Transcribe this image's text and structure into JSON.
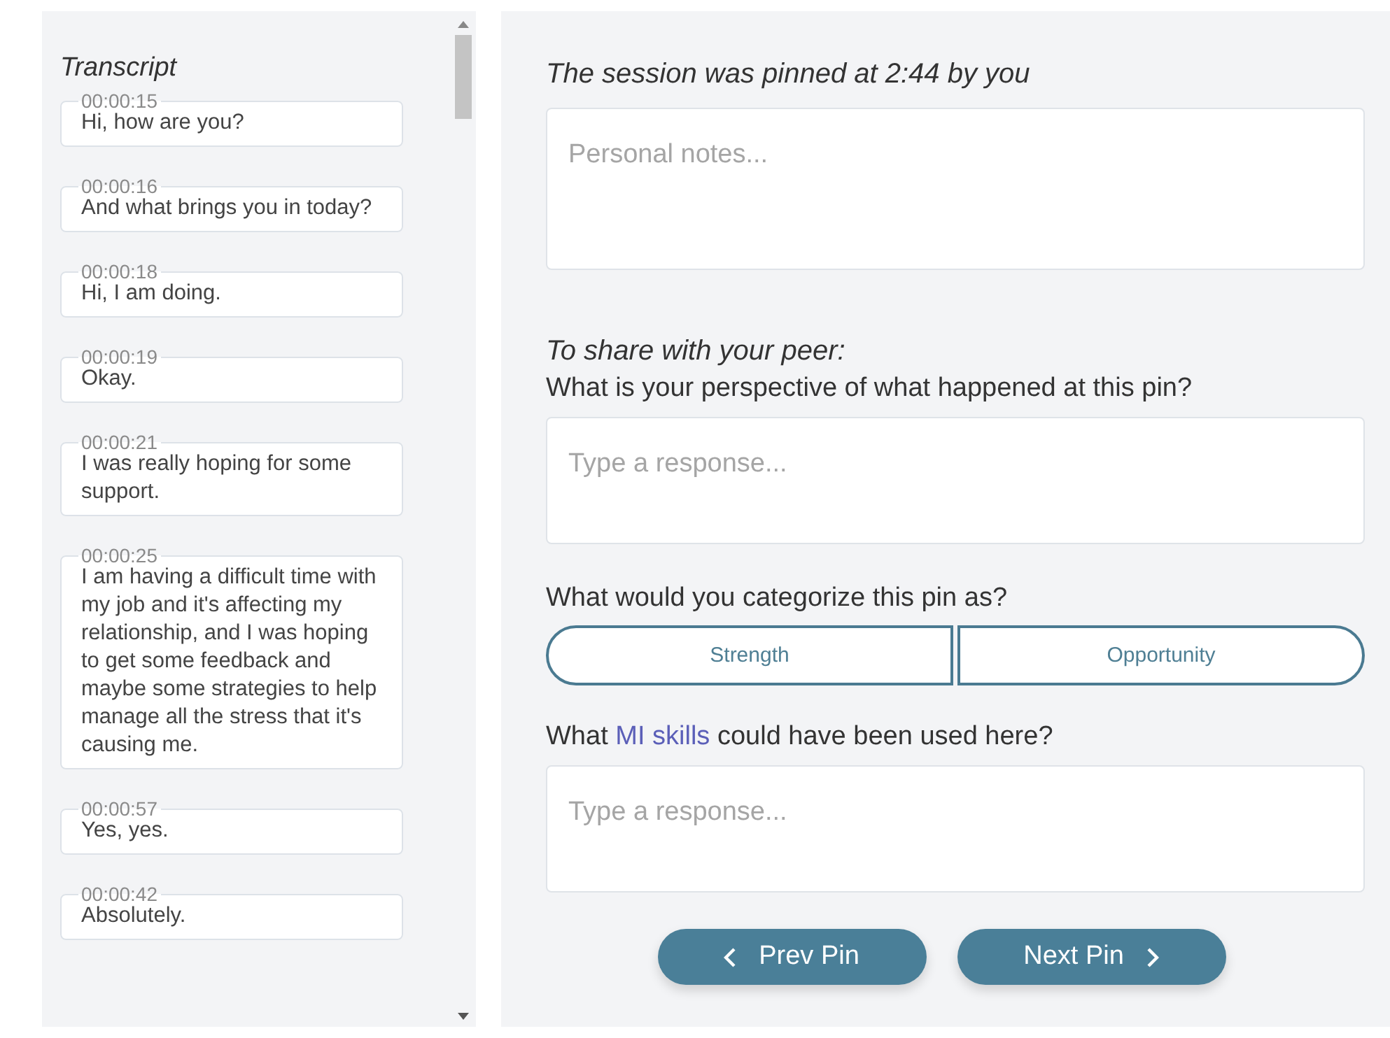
{
  "transcript": {
    "title": "Transcript",
    "entries": [
      {
        "time": "00:00:15",
        "text": "Hi, how are you?"
      },
      {
        "time": "00:00:16",
        "text": "And what brings you in today?"
      },
      {
        "time": "00:00:18",
        "text": "Hi, I am doing."
      },
      {
        "time": "00:00:19",
        "text": "Okay."
      },
      {
        "time": "00:00:21",
        "text": "I was really hoping for some support."
      },
      {
        "time": "00:00:25",
        "text": "I am having a difficult time with my job and it's affecting my relationship, and I was hoping to get some feedback and maybe some strategies to help manage all the stress that it's causing me."
      },
      {
        "time": "00:00:57",
        "text": "Yes, yes."
      },
      {
        "time": "00:00:42",
        "text": "Absolutely."
      }
    ]
  },
  "pin": {
    "heading": "The session was pinned at 2:44 by you",
    "notes_placeholder": "Personal notes...",
    "share_heading": "To share with your peer:",
    "perspective_question": "What is your perspective of what happened at this pin?",
    "perspective_placeholder": "Type a response...",
    "category_question": "What would you categorize this pin as?",
    "categories": [
      {
        "label": "Strength",
        "selected": false
      },
      {
        "label": "Opportunity",
        "selected": false
      }
    ],
    "skills_question": {
      "before": "What",
      "link": "MI skills",
      "after": "could have been used here?"
    },
    "skills_placeholder": "Type a response...",
    "buttons": [
      {
        "kind": "prev",
        "label": "Prev Pin"
      },
      {
        "kind": "next",
        "label": "Next Pin"
      }
    ]
  }
}
